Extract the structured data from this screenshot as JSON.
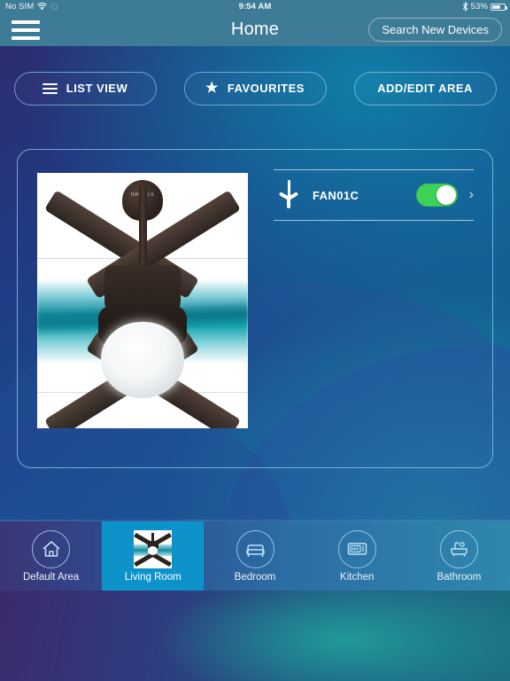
{
  "status_bar": {
    "carrier": "No SIM",
    "wifi_icon": "wifi-icon",
    "sync_icon": "sync-spinner-icon",
    "time": "9:54 AM",
    "bluetooth_icon": "bluetooth-icon",
    "battery_percent": "53%",
    "battery_icon": "battery-icon"
  },
  "navbar": {
    "menu_icon": "hamburger-menu-icon",
    "title": "Home",
    "search_label": "Search New Devices",
    "background_color": "#3d7b96"
  },
  "toolbar": {
    "buttons": [
      {
        "label": "LIST VIEW",
        "icon": "list-icon"
      },
      {
        "label": "FAVOURITES",
        "icon": "star-icon"
      },
      {
        "label": "ADD/EDIT AREA",
        "icon": "none"
      }
    ]
  },
  "card": {
    "product_image": "ceiling-fan-photo",
    "product_brand": "HAVELLS",
    "devices": [
      {
        "icon": "fan-icon",
        "name": "FAN01C",
        "toggle_state": "on",
        "toggle_color": "#3ed158",
        "chevron": "›"
      }
    ]
  },
  "tabbar": {
    "active_index": 1,
    "active_color": "#0d93c9",
    "tabs": [
      {
        "label": "Default Area",
        "icon": "home-icon"
      },
      {
        "label": "Living Room",
        "icon": "ceiling-fan-thumbnail"
      },
      {
        "label": "Bedroom",
        "icon": "bed-icon"
      },
      {
        "label": "Kitchen",
        "icon": "microwave-icon"
      },
      {
        "label": "Bathroom",
        "icon": "bathtub-icon"
      }
    ]
  }
}
